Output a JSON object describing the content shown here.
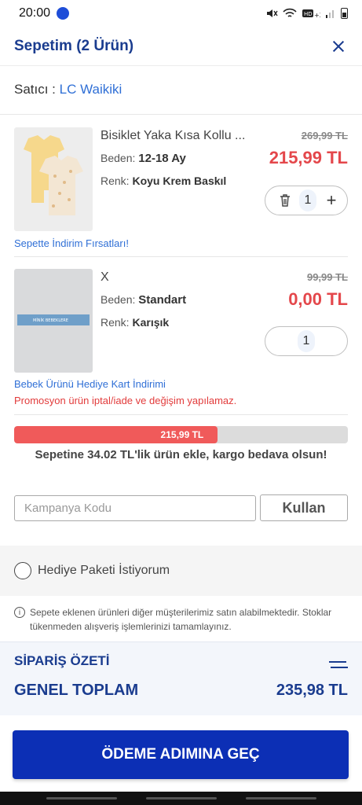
{
  "status_bar": {
    "time": "20:00"
  },
  "header": {
    "title": "Sepetim (2 Ürün)"
  },
  "seller": {
    "label": "Satıcı :",
    "name": "LC Waikiki"
  },
  "products": [
    {
      "name": "Bisiklet Yaka Kısa Kollu ...",
      "size_label": "Beden:",
      "size": "12-18 Ay",
      "color_label": "Renk:",
      "color": "Koyu Krem Baskıl",
      "old_price": "269,99 TL",
      "price": "215,99 TL",
      "quantity": "1",
      "promo": "Sepette İndirim Fırsatları!"
    },
    {
      "name": "X",
      "size_label": "Beden:",
      "size": "Standart",
      "color_label": "Renk:",
      "color": "Karışık",
      "old_price": "99,99 TL",
      "price": "0,00 TL",
      "quantity": "1",
      "promo": "Bebek Ürünü Hediye Kart İndirimi",
      "warning": "Promosyon ürün iptal/iade ve değişim yapılamaz.",
      "image_text": "MİNİK BEBEKLERE"
    }
  ],
  "progress": {
    "label": "215,99 TL",
    "fraction": 0.61,
    "message": "Sepetine 34.02 TL'lik ürün ekle, kargo bedava olsun!"
  },
  "campaign": {
    "placeholder": "Kampanya Kodu",
    "button": "Kullan"
  },
  "gift": {
    "label": "Hediye Paketi İstiyorum"
  },
  "info": {
    "text": "Sepete eklenen ürünleri diğer müşterilerimiz satın alabilmektedir. Stoklar tükenmeden alışveriş işlemlerinizi tamamlayınız."
  },
  "summary": {
    "title": "SİPARİŞ ÖZETİ",
    "total_label": "GENEL TOPLAM",
    "total_value": "235,98 TL"
  },
  "checkout": {
    "button": "ÖDEME ADIMINA GEÇ"
  },
  "colors": {
    "brand_blue": "#1a3c8f",
    "button_blue": "#0c2fb5",
    "price_red": "#e4474b",
    "link_blue": "#2f6fd6"
  }
}
